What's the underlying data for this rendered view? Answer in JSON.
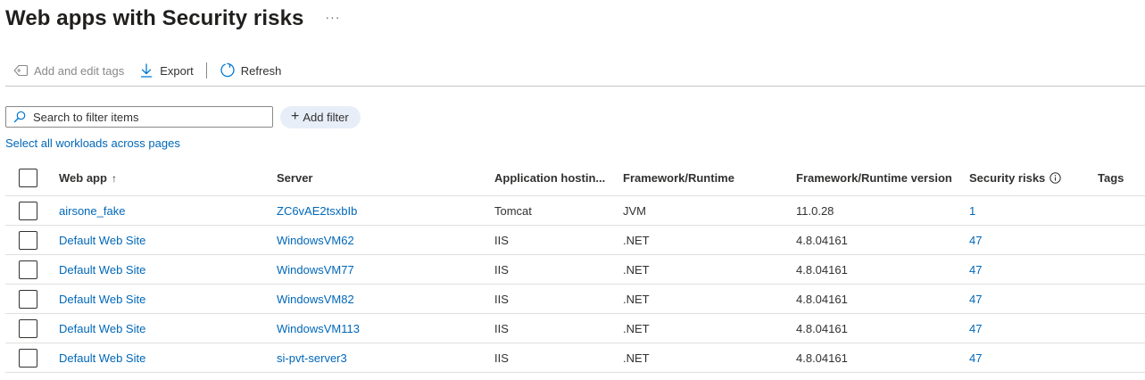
{
  "page": {
    "title": "Web apps with Security risks",
    "more_label": "···"
  },
  "toolbar": {
    "tags_label": "Add and edit tags",
    "export_label": "Export",
    "refresh_label": "Refresh"
  },
  "filters": {
    "search_placeholder": "Search to filter items",
    "add_filter_label": "Add filter",
    "select_all_label": "Select all workloads across pages"
  },
  "table": {
    "columns": {
      "web_app": "Web app",
      "sort_indicator": "↑",
      "server": "Server",
      "hosting": "Application hostin...",
      "framework": "Framework/Runtime",
      "version": "Framework/Runtime version",
      "risks": "Security risks",
      "tags": "Tags"
    },
    "rows": [
      {
        "web_app": "airsone_fake",
        "server": "ZC6vAE2tsxbIb",
        "hosting": "Tomcat",
        "framework": "JVM",
        "version": "11.0.28",
        "risks": "1",
        "tags": ""
      },
      {
        "web_app": "Default Web Site",
        "server": "WindowsVM62",
        "hosting": "IIS",
        "framework": ".NET",
        "version": "4.8.04161",
        "risks": "47",
        "tags": ""
      },
      {
        "web_app": "Default Web Site",
        "server": "WindowsVM77",
        "hosting": "IIS",
        "framework": ".NET",
        "version": "4.8.04161",
        "risks": "47",
        "tags": ""
      },
      {
        "web_app": "Default Web Site",
        "server": "WindowsVM82",
        "hosting": "IIS",
        "framework": ".NET",
        "version": "4.8.04161",
        "risks": "47",
        "tags": ""
      },
      {
        "web_app": "Default Web Site",
        "server": "WindowsVM113",
        "hosting": "IIS",
        "framework": ".NET",
        "version": "4.8.04161",
        "risks": "47",
        "tags": ""
      },
      {
        "web_app": "Default Web Site",
        "server": "si-pvt-server3",
        "hosting": "IIS",
        "framework": ".NET",
        "version": "4.8.04161",
        "risks": "47",
        "tags": ""
      }
    ]
  },
  "icons": {
    "tag": "tag-icon",
    "export": "download-icon",
    "refresh": "refresh-icon",
    "search": "search-icon",
    "add": "plus-icon",
    "info": "info-icon"
  },
  "colors": {
    "link": "#0067b8",
    "primary_icon": "#0078d4",
    "filter_pill": "#e7eef8"
  }
}
